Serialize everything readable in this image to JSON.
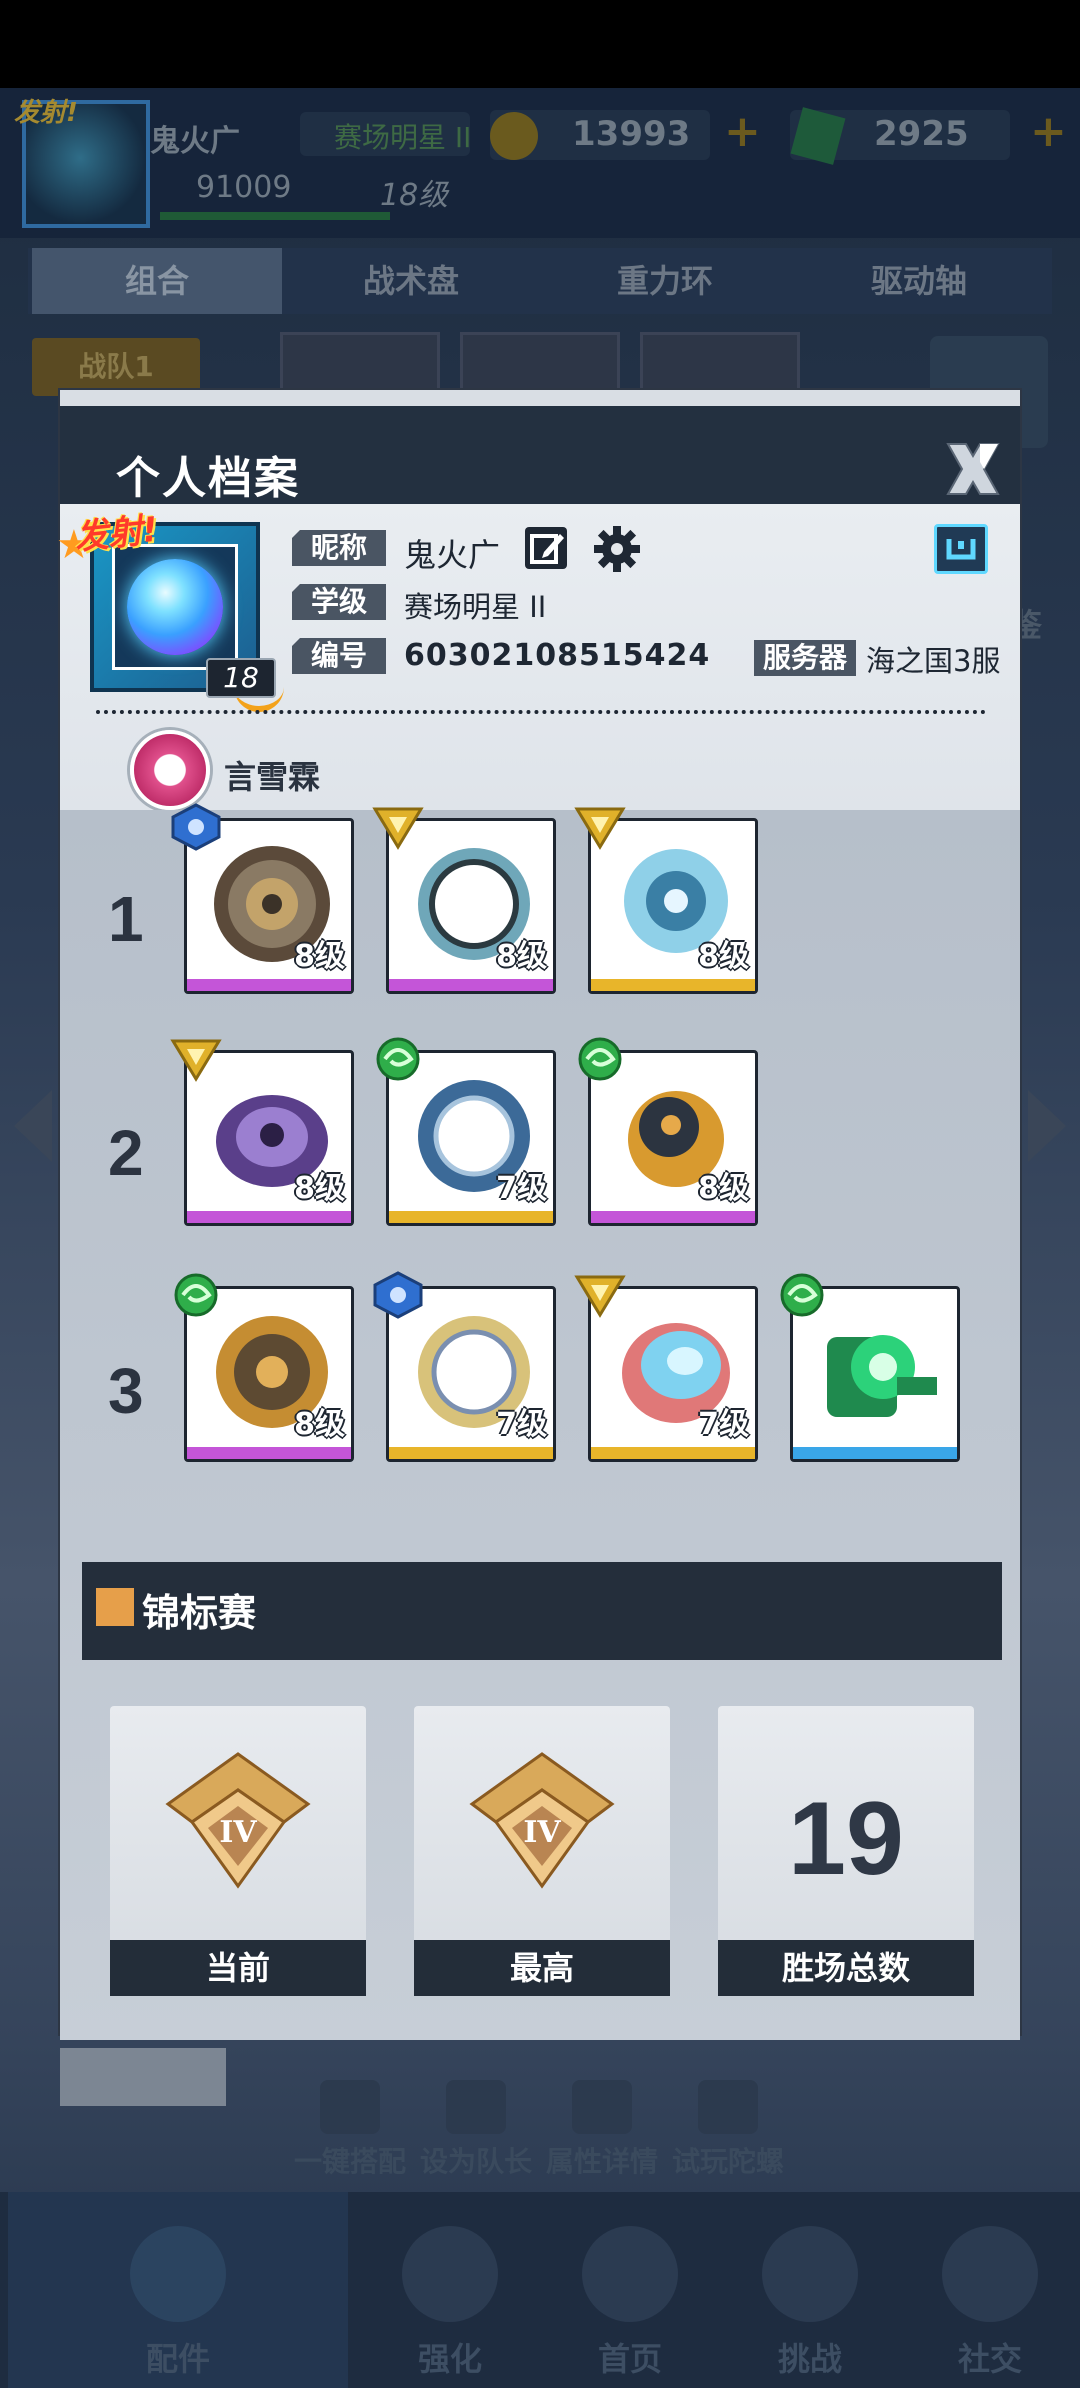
{
  "background": {
    "player_name": "鬼火广",
    "player_title": "赛场明星 II",
    "coins": "13993",
    "gems": "2925",
    "power": "91009",
    "level": "18级",
    "avatar_tag": "发射!",
    "tabs": [
      "组合",
      "战术盘",
      "重力环",
      "驱动轴"
    ],
    "team_label": "战队1",
    "side_label": "鉴",
    "actions": [
      "一键搭配",
      "设为队长",
      "属性详情",
      "试玩陀螺"
    ],
    "bottom_nav": [
      "配件",
      "强化",
      "首页",
      "挑战",
      "社交"
    ]
  },
  "modal": {
    "title": "个人档案",
    "profile": {
      "avatar_tag": "发射!",
      "avatar_level": "18",
      "nickname_label": "昵称",
      "nickname": "鬼火广",
      "grade_label": "学级",
      "grade": "赛场明星 II",
      "id_label": "编号",
      "id": "60302108515424",
      "server_label": "服务器",
      "server": "海之国3服",
      "guild_name": "言雪霖"
    },
    "teams": [
      {
        "row": "1",
        "parts": [
          {
            "level": "8级",
            "rarity_color": "#c455d8",
            "badge": "hex-blue"
          },
          {
            "level": "8级",
            "rarity_color": "#c455d8",
            "badge": "triangle-gold"
          },
          {
            "level": "8级",
            "rarity_color": "#e8b52a",
            "badge": "triangle-gold"
          }
        ]
      },
      {
        "row": "2",
        "parts": [
          {
            "level": "8级",
            "rarity_color": "#c455d8",
            "badge": "triangle-gold"
          },
          {
            "level": "7级",
            "rarity_color": "#e8b52a",
            "badge": "swirl-green"
          },
          {
            "level": "8级",
            "rarity_color": "#c455d8",
            "badge": "swirl-green"
          }
        ]
      },
      {
        "row": "3",
        "parts": [
          {
            "level": "8级",
            "rarity_color": "#c455d8",
            "badge": "swirl-green"
          },
          {
            "level": "7级",
            "rarity_color": "#e8b52a",
            "badge": "hex-blue"
          },
          {
            "level": "7级",
            "rarity_color": "#e8b52a",
            "badge": "triangle-gold"
          },
          {
            "level": "",
            "rarity_color": "#3aa6e8",
            "badge": "swirl-green"
          }
        ]
      }
    ],
    "championship": {
      "title": "锦标赛",
      "current_label": "当前",
      "current_rank": "IV",
      "best_label": "最高",
      "best_rank": "IV",
      "wins_label": "胜场总数",
      "wins": "19"
    }
  }
}
